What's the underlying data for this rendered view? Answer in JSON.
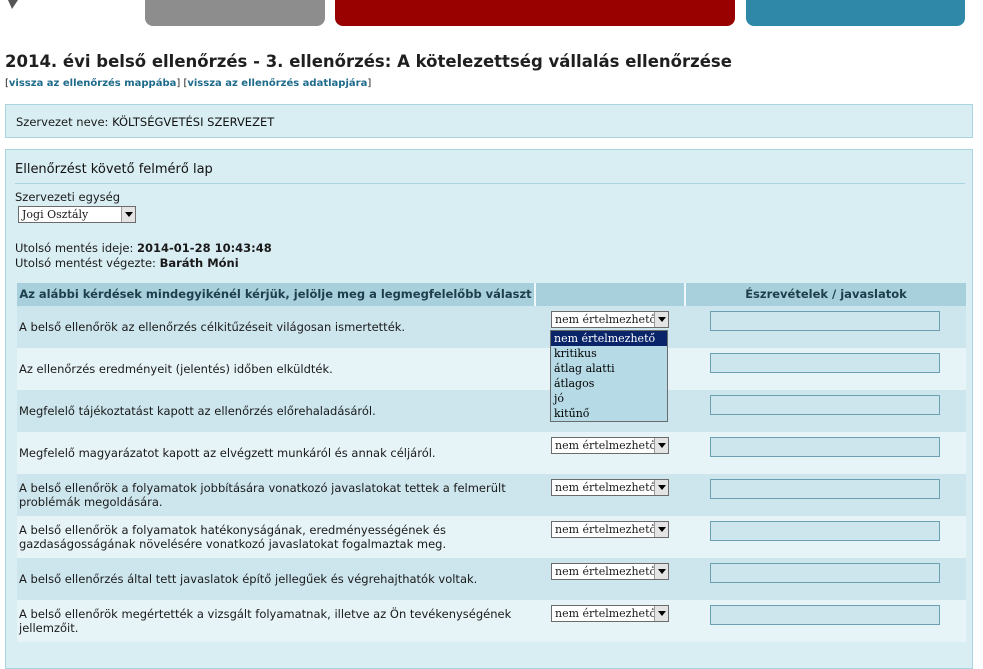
{
  "title": "2014. évi belső ellenőrzés - 3. ellenőrzés: A kötelezettség vállalás ellenőrzése",
  "links": {
    "back_folder": "vissza az ellenőrzés mappába",
    "back_data": "vissza az ellenőrzés adatlapjára"
  },
  "org": {
    "label": "Szervezet neve:",
    "value": "KÖLTSÉGVETÉSI SZERVEZET"
  },
  "form": {
    "title": "Ellenőrzést követő felmérő lap",
    "unit_label": "Szervezeti egység",
    "unit_value": "Jogi Osztály",
    "last_save_label": "Utolsó mentés ideje:",
    "last_save_value": "2014-01-28 10:43:48",
    "last_saver_label": "Utolsó mentést végezte:",
    "last_saver_value": "Baráth Móni"
  },
  "table": {
    "headers": [
      "Az alábbi kérdések mindegyikénél kérjük, jelölje meg a legmegfelelőbb választ",
      "",
      "Észrevételek / javaslatok"
    ],
    "rows": [
      {
        "question": "A belső ellenőrök az ellenőrzés célkitűzéseit világosan ismertették.",
        "answer": "nem értelmezhető"
      },
      {
        "question": "Az ellenőrzés eredményeit (jelentés) időben elküldték.",
        "answer": ""
      },
      {
        "question": "Megfelelő tájékoztatást kapott az ellenőrzés előrehaladásáról.",
        "answer": ""
      },
      {
        "question": "Megfelelő magyarázatot kapott az elvégzett munkáról és annak céljáról.",
        "answer": "nem értelmezhető"
      },
      {
        "question": "A belső ellenőrök a folyamatok jobbítására vonatkozó javaslatokat tettek a felmerült problémák megoldására.",
        "answer": "nem értelmezhető"
      },
      {
        "question": "A belső ellenőrök a folyamatok hatékonyságának, eredményességének és gazdaságosságának növelésére vonatkozó javaslatokat fogalmaztak meg.",
        "answer": "nem értelmezhető"
      },
      {
        "question": "A belső ellenőrzés által tett javaslatok építő jellegűek és végrehajthatók voltak.",
        "answer": "nem értelmezhető"
      },
      {
        "question": "A belső ellenőrök megértették a vizsgált folyamatnak, illetve az Ön tevékenységének jellemzőit.",
        "answer": "nem értelmezhető"
      }
    ]
  },
  "dropdown": {
    "options": [
      "nem értelmezhető",
      "kritikus",
      "átlag alatti",
      "átlagos",
      "jó",
      "kitűnő"
    ],
    "selected_index": 0
  },
  "colors": {
    "tab_gray": "#8d8d8d",
    "tab_red": "#990000",
    "tab_blue": "#2f88a8",
    "panel_bg": "#d9eef3",
    "header_bg": "#a7d0dc",
    "selected_option": "#0a246a"
  }
}
